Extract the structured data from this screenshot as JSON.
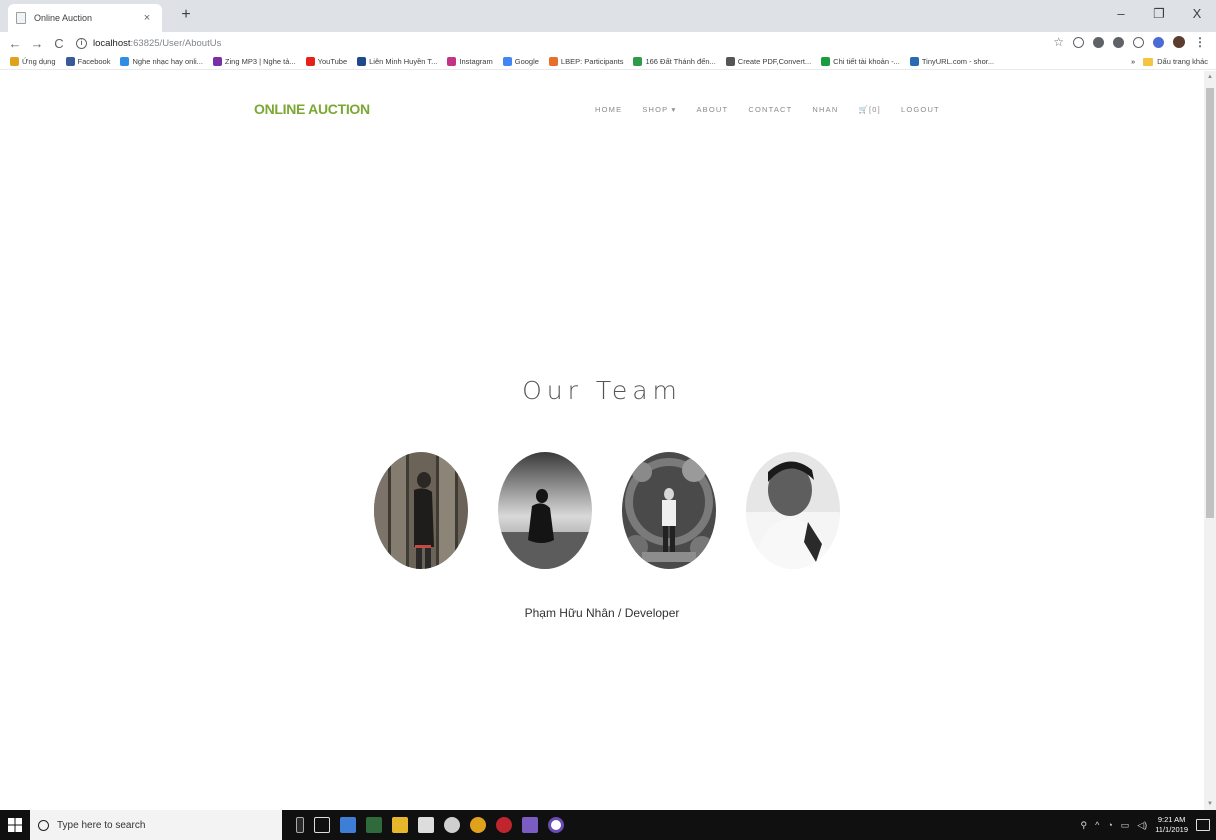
{
  "browser": {
    "tab_title": "Online Auction",
    "tab_close": "×",
    "new_tab": "+",
    "window_controls": {
      "minimize": "–",
      "restore": "❐",
      "close": "X"
    },
    "nav": {
      "back": "←",
      "forward": "→",
      "reload": "C"
    },
    "url_host": "localhost",
    "url_path": ":63825/User/AboutUs",
    "bookmarks": [
      {
        "label": "Ứng dụng",
        "color": "#e0a21d"
      },
      {
        "label": "Facebook",
        "color": "#3b5998"
      },
      {
        "label": "Nghe nhạc hay onli...",
        "color": "#2f8de4"
      },
      {
        "label": "Zing MP3 | Nghe tả...",
        "color": "#7b2fa6"
      },
      {
        "label": "YouTube",
        "color": "#e62117"
      },
      {
        "label": "Liên Minh Huyền T...",
        "color": "#1e4a8c"
      },
      {
        "label": "Instagram",
        "color": "#c13584"
      },
      {
        "label": "Google",
        "color": "#4285f4"
      },
      {
        "label": "LBEP: Participants",
        "color": "#e76f2b"
      },
      {
        "label": "166 Đất Thánh đến...",
        "color": "#2c9c4a"
      },
      {
        "label": "Create PDF,Convert...",
        "color": "#555555"
      },
      {
        "label": "Chi tiết tài khoản -...",
        "color": "#1a9c3e"
      },
      {
        "label": "TinyURL.com - shor...",
        "color": "#2a6ab5"
      }
    ],
    "bookmarks_overflow": "»",
    "other_bookmarks": "Dấu trang khác"
  },
  "site": {
    "brand": "ONLINE AUCTION",
    "nav": {
      "home": "HOME",
      "shop": "SHOP ▾",
      "about": "ABOUT",
      "contact": "CONTACT",
      "user": "NHAN",
      "cart": "🛒[0]",
      "logout": "LOGOUT"
    },
    "team_title": "Our Team",
    "member_caption": "Phạm Hữu Nhân / Developer"
  },
  "taskbar": {
    "search_placeholder": "Type here to search",
    "time": "9:21 AM",
    "date": "11/1/2019"
  },
  "colors": {
    "brand_green": "#7aa832",
    "taskbar": "#101010"
  }
}
